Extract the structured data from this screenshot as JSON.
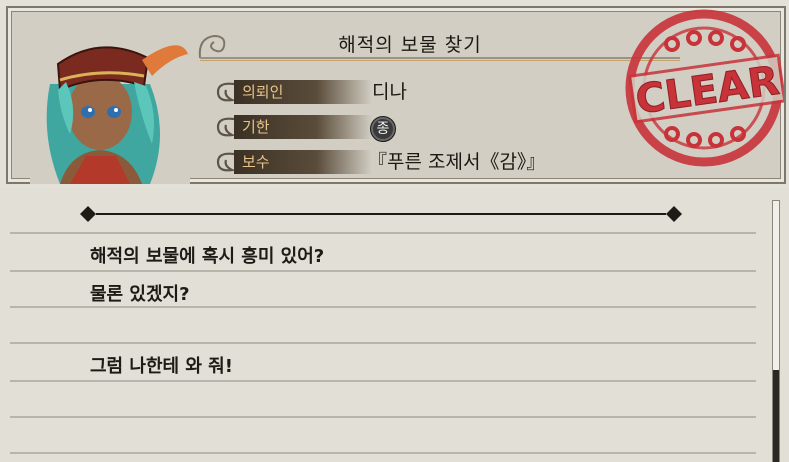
{
  "quest": {
    "title": "해적의 보물 찾기",
    "fields": [
      {
        "label": "의뢰인",
        "value": "디나"
      },
      {
        "label": "기한",
        "value": "종"
      },
      {
        "label": "보수",
        "value": "『푸른 조제서《감》』"
      }
    ],
    "stamp_text": "CLEAR"
  },
  "dialog": {
    "lines": [
      "해적의 보물에 혹시 흥미 있어?",
      "물론 있겠지?",
      "",
      "그럼 나한테 와 줘!"
    ]
  },
  "scroll": {
    "position": 0.65
  },
  "colors": {
    "stamp": "#c8333a",
    "label_text": "#e8c48a",
    "parchment": "#e2dfd7"
  }
}
